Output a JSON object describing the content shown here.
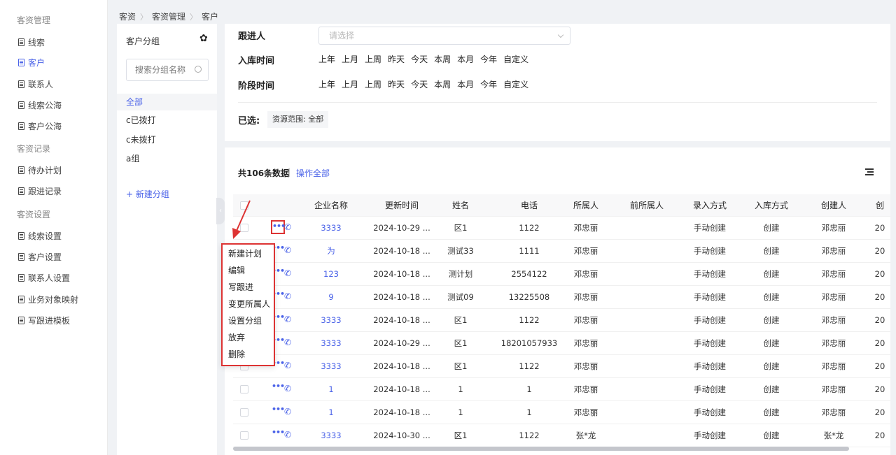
{
  "sidebar": {
    "sections": [
      "客资管理",
      "客资记录",
      "客资设置"
    ],
    "items": [
      {
        "label": "线索"
      },
      {
        "label": "客户"
      },
      {
        "label": "联系人"
      },
      {
        "label": "线索公海"
      },
      {
        "label": "客户公海"
      },
      {
        "label": "待办计划"
      },
      {
        "label": "跟进记录"
      },
      {
        "label": "线索设置"
      },
      {
        "label": "客户设置"
      },
      {
        "label": "联系人设置"
      },
      {
        "label": "业务对象映射"
      },
      {
        "label": "写跟进模板"
      }
    ],
    "active": "客户"
  },
  "breadcrumb": [
    "客资",
    "客资管理",
    "客户"
  ],
  "groups": {
    "title": "客户分组",
    "search_placeholder": "搜索分组名称",
    "items": [
      "全部",
      "c已拨打",
      "c未拨打",
      "a组"
    ],
    "new_label": "+ 新建分组"
  },
  "filter": {
    "follower_label": "跟进人",
    "follower_placeholder": "请选择",
    "entry_time_label": "入库时间",
    "stage_time_label": "阶段时间",
    "time_options": [
      "上年",
      "上月",
      "上周",
      "昨天",
      "今天",
      "本周",
      "本月",
      "今年",
      "自定义"
    ],
    "selected_label": "已选:",
    "selected_chip": "资源范围: 全部"
  },
  "list": {
    "count_text": "共106条数据",
    "separator": "|",
    "operate_all": "操作全部",
    "columns": [
      "企业名称",
      "更新时间",
      "姓名",
      "电话",
      "所属人",
      "前所属人",
      "录入方式",
      "入库方式",
      "创建人",
      "创"
    ],
    "rows": [
      {
        "company": "3333",
        "updated": "2024-10-29 ...",
        "name": "区1",
        "phone": "1122",
        "owner": "邓忠丽",
        "prev_owner": "",
        "entry": "手动创建",
        "storage": "创建",
        "creator": "邓忠丽",
        "created": "20"
      },
      {
        "company": "为",
        "updated": "2024-10-18 ...",
        "name": "测试33",
        "phone": "1111",
        "owner": "邓忠丽",
        "prev_owner": "",
        "entry": "手动创建",
        "storage": "创建",
        "creator": "邓忠丽",
        "created": "20"
      },
      {
        "company": "123",
        "updated": "2024-10-18 ...",
        "name": "测计划",
        "phone": "2554122",
        "owner": "邓忠丽",
        "prev_owner": "",
        "entry": "手动创建",
        "storage": "创建",
        "creator": "邓忠丽",
        "created": "20"
      },
      {
        "company": "9",
        "updated": "2024-10-18 ...",
        "name": "测试09",
        "phone": "13225508",
        "owner": "邓忠丽",
        "prev_owner": "",
        "entry": "手动创建",
        "storage": "创建",
        "creator": "邓忠丽",
        "created": "20"
      },
      {
        "company": "3333",
        "updated": "2024-10-18 ...",
        "name": "区1",
        "phone": "1122",
        "owner": "邓忠丽",
        "prev_owner": "",
        "entry": "手动创建",
        "storage": "创建",
        "creator": "邓忠丽",
        "created": "20"
      },
      {
        "company": "3333",
        "updated": "2024-10-29 ...",
        "name": "区1",
        "phone": "18201057933",
        "owner": "邓忠丽",
        "prev_owner": "",
        "entry": "手动创建",
        "storage": "创建",
        "creator": "邓忠丽",
        "created": "20"
      },
      {
        "company": "3333",
        "updated": "2024-10-18 ...",
        "name": "区1",
        "phone": "1122",
        "owner": "邓忠丽",
        "prev_owner": "",
        "entry": "手动创建",
        "storage": "创建",
        "creator": "邓忠丽",
        "created": "20"
      },
      {
        "company": "1",
        "updated": "2024-10-18 ...",
        "name": "1",
        "phone": "1",
        "owner": "邓忠丽",
        "prev_owner": "",
        "entry": "手动创建",
        "storage": "创建",
        "creator": "邓忠丽",
        "created": "20"
      },
      {
        "company": "1",
        "updated": "2024-10-18 ...",
        "name": "1",
        "phone": "1",
        "owner": "邓忠丽",
        "prev_owner": "",
        "entry": "手动创建",
        "storage": "创建",
        "creator": "邓忠丽",
        "created": "20"
      },
      {
        "company": "3333",
        "updated": "2024-10-30 ...",
        "name": "区1",
        "phone": "1122",
        "owner": "张*龙",
        "prev_owner": "",
        "entry": "手动创建",
        "storage": "创建",
        "creator": "张*龙",
        "created": "20"
      }
    ]
  },
  "row_menu": {
    "items": [
      "新建计划",
      "编辑",
      "写跟进",
      "变更所属人",
      "设置分组",
      "放弃",
      "删除"
    ]
  },
  "colors": {
    "accent": "#4a62e8",
    "highlight": "#dd3333"
  }
}
